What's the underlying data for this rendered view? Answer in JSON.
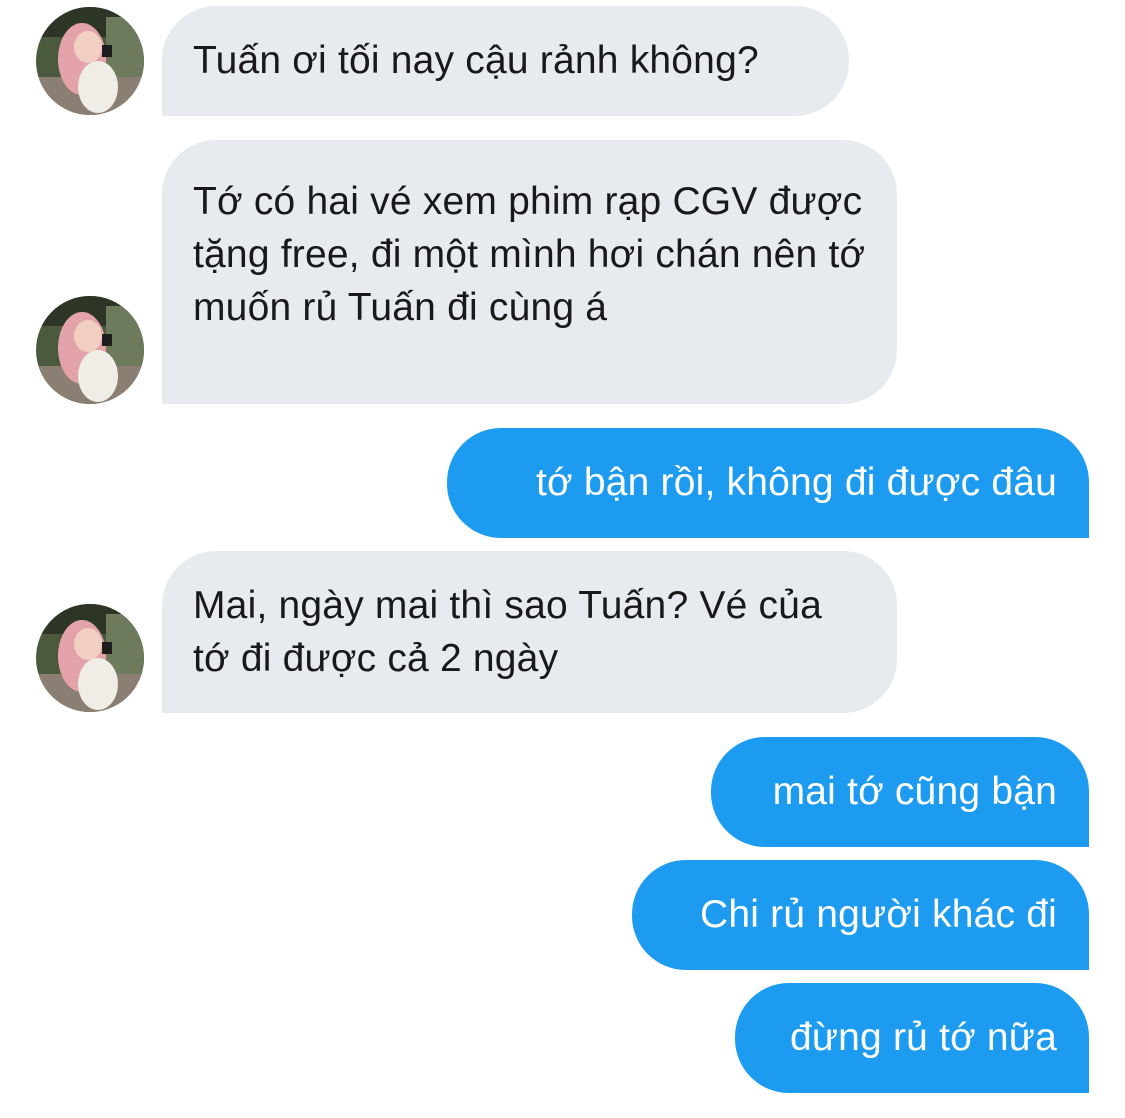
{
  "conversation": {
    "messages": [
      {
        "sender": "them",
        "text": "Tuấn ơi tối nay cậu rảnh không?"
      },
      {
        "sender": "them",
        "text": "Tớ có hai vé xem phim rạp CGV được tặng free, đi một mình hơi chán nên tớ muốn rủ Tuấn đi cùng á"
      },
      {
        "sender": "me",
        "text": "tớ bận rồi, không đi được đâu"
      },
      {
        "sender": "them",
        "text": " Mai, ngày mai thì sao Tuấn? Vé của tớ đi được cả 2 ngày"
      },
      {
        "sender": "me",
        "text": "mai tớ cũng bận"
      },
      {
        "sender": "me",
        "text": "Chi rủ người khác đi"
      },
      {
        "sender": "me",
        "text": "đừng rủ tớ nữa"
      }
    ]
  },
  "colors": {
    "incoming_bubble": "#e7ebf0",
    "outgoing_bubble": "#1d9bf0",
    "incoming_text": "#191919",
    "outgoing_text": "#ffffff"
  },
  "icons": {
    "contact_avatar": "contact-avatar-photo"
  }
}
